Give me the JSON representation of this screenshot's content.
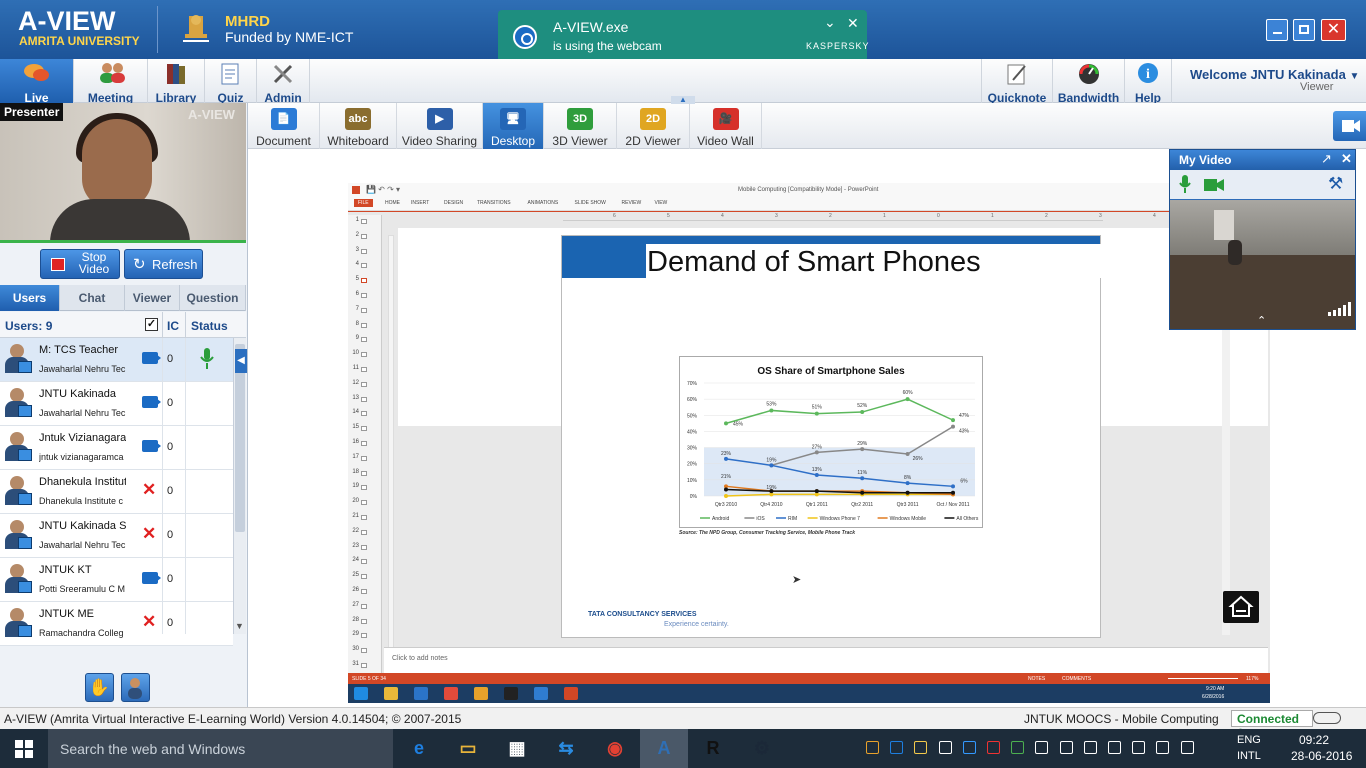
{
  "app": {
    "title": "A-VIEW",
    "subtitle": "AMRITA UNIVERSITY",
    "mhrd": "MHRD",
    "funded": "Funded by NME-ICT"
  },
  "toast": {
    "title": "A-VIEW.exe",
    "message": "is using the webcam",
    "brand": "KASPERSKY"
  },
  "nav": {
    "items": [
      {
        "label": "Live Session",
        "icon": "chat-bubbles-icon"
      },
      {
        "label": "Meeting",
        "icon": "people-icon"
      },
      {
        "label": "Library",
        "icon": "books-icon"
      },
      {
        "label": "Quiz",
        "icon": "quiz-icon"
      },
      {
        "label": "Admin",
        "icon": "tools-icon"
      }
    ],
    "right": [
      {
        "label": "Quicknote",
        "icon": "note-icon"
      },
      {
        "label": "Bandwidth",
        "icon": "gauge-icon"
      },
      {
        "label": "Help",
        "icon": "info-icon"
      }
    ],
    "welcome": "Welcome JNTU Kakinada",
    "role": "Viewer"
  },
  "tools": [
    {
      "label": "Document"
    },
    {
      "label": "Whiteboard"
    },
    {
      "label": "Video Sharing"
    },
    {
      "label": "Desktop"
    },
    {
      "label": "3D Viewer"
    },
    {
      "label": "2D Viewer"
    },
    {
      "label": "Video Wall"
    }
  ],
  "presenter": {
    "label": "Presenter",
    "watermark": "A-VIEW",
    "stop_label": "Stop Video",
    "refresh_label": "Refresh"
  },
  "tabs": [
    "Users",
    "Chat",
    "Viewer",
    "Question"
  ],
  "users_header": {
    "count": "Users: 9",
    "ic": "IC",
    "status": "Status"
  },
  "users": [
    {
      "name": "M: TCS Teacher",
      "inst": "Jawaharlal Nehru Tec",
      "video": "cam",
      "count": "0",
      "mic": true
    },
    {
      "name": "JNTU Kakinada",
      "inst": "Jawaharlal Nehru Tec",
      "video": "cam",
      "count": "0",
      "mic": false
    },
    {
      "name": "Jntuk Vizianagara",
      "inst": "jntuk vizianagaramca",
      "video": "cam",
      "count": "0",
      "mic": false
    },
    {
      "name": "Dhanekula Institute",
      "inst": "Dhanekula Institute c",
      "video": "x",
      "count": "0",
      "mic": false
    },
    {
      "name": "JNTU Kakinada St",
      "inst": "Jawaharlal Nehru Tec",
      "video": "x",
      "count": "0",
      "mic": false
    },
    {
      "name": "JNTUK KT",
      "inst": "Potti Sreeramulu C M",
      "video": "cam",
      "count": "0",
      "mic": false
    },
    {
      "name": "JNTUK ME",
      "inst": "Ramachandra Colleg",
      "video": "x",
      "count": "0",
      "mic": false
    }
  ],
  "ppt": {
    "title_bar": "Mobile Computing [Compatibility Mode] - PowerPoint",
    "ribbon": [
      "FILE",
      "HOME",
      "INSERT",
      "DESIGN",
      "TRANSITIONS",
      "ANIMATIONS",
      "SLIDE SHOW",
      "REVIEW",
      "VIEW"
    ],
    "ruler_ticks": [
      "6",
      "5",
      "4",
      "3",
      "2",
      "1",
      "0",
      "1",
      "2",
      "3",
      "4"
    ],
    "slide_title": "Demand of Smart Phones",
    "notes": "Click to add notes",
    "status_left": "SLIDE 5 OF 34",
    "status_right": [
      "NOTES",
      "COMMENTS"
    ],
    "zoom": "117%",
    "footer_logo": "TATA CONSULTANCY SERVICES",
    "footer_tag": "Experience certainty.",
    "source": "Source: The NPD Group, Consumer Tracking Service, Mobile Phone Track",
    "mini_time": "9:20 AM",
    "mini_date": "6/28/2016"
  },
  "chart_data": {
    "type": "line",
    "title": "OS Share of Smartphone Sales",
    "categories": [
      "Qtr3 2010",
      "Qtr4 2010",
      "Qtr1 2011",
      "Qtr2 2011",
      "Qtr3 2011",
      "Oct / Nov 2011"
    ],
    "ylim": [
      0,
      70
    ],
    "yticks": [
      "70%",
      "60%",
      "50%",
      "40%",
      "30%",
      "20%",
      "10%",
      "0%"
    ],
    "series": [
      {
        "name": "Android",
        "color": "#5cb85c",
        "values": [
          45,
          53,
          51,
          52,
          60,
          47
        ]
      },
      {
        "name": "iOS",
        "color": "#888888",
        "values": [
          null,
          19,
          27,
          29,
          26,
          43
        ]
      },
      {
        "name": "RIM",
        "color": "#2e6fc7",
        "values": [
          23,
          19,
          13,
          11,
          8,
          6
        ]
      },
      {
        "name": "Windows Phone 7",
        "color": "#f0c419",
        "values": [
          0,
          1,
          1,
          1,
          1,
          1
        ]
      },
      {
        "name": "Windows Mobile",
        "color": "#e07a20",
        "values": [
          6,
          3,
          3,
          3,
          2,
          1
        ]
      },
      {
        "name": "All Others",
        "color": "#111111",
        "values": [
          4,
          3,
          3,
          2,
          2,
          2
        ]
      }
    ],
    "labels": [
      {
        "series": "Android",
        "texts": [
          "45%",
          "53%",
          "51%",
          "52%",
          "60%",
          "47%"
        ]
      },
      {
        "series": "iOS",
        "texts": [
          "",
          "",
          "27%",
          "29%",
          "26%",
          "43%"
        ]
      },
      {
        "series": "RIM",
        "texts": [
          "23%",
          "19%",
          "13%",
          "11%",
          "8%",
          "6%"
        ]
      },
      {
        "series": "extra",
        "texts": [
          "21%",
          "19%"
        ]
      }
    ]
  },
  "myvideo": {
    "title": "My Video"
  },
  "statusbar": {
    "left": "A-VIEW (Amrita Virtual Interactive E-Learning World) Version 4.0.14504; © 2007-2015",
    "course": "JNTUK MOOCS - Mobile Computing",
    "connected": "Connected ^"
  },
  "taskbar": {
    "search": "Search the web and Windows",
    "lang1": "ENG",
    "lang2": "INTL",
    "time": "09:22",
    "date": "28-06-2016"
  }
}
